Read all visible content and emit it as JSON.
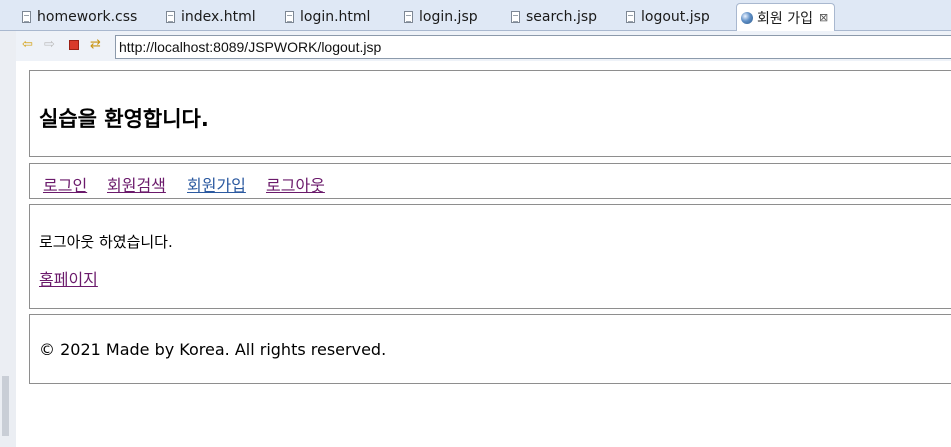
{
  "tabs": [
    {
      "label": "homework.css",
      "icon": "file-icon"
    },
    {
      "label": "index.html",
      "icon": "file-icon"
    },
    {
      "label": "login.html",
      "icon": "file-icon"
    },
    {
      "label": "login.jsp",
      "icon": "file-icon"
    },
    {
      "label": "search.jsp",
      "icon": "file-icon"
    },
    {
      "label": "logout.jsp",
      "icon": "file-icon"
    },
    {
      "label": "회원 가입",
      "icon": "globe-icon",
      "active": true,
      "close": "⊠"
    }
  ],
  "toolbar": {
    "back_icon": "⇦",
    "forward_icon": "⇨",
    "refresh_icon": "⇄",
    "url": "http://localhost:8089/JSPWORK/logout.jsp"
  },
  "page": {
    "title": "실습을 환영합니다.",
    "nav": [
      {
        "label": "로그인"
      },
      {
        "label": "회원검색"
      },
      {
        "label": "회원가입"
      },
      {
        "label": "로그아웃"
      }
    ],
    "message": "로그아웃 하였습니다.",
    "home_link": "홈페이지",
    "footer": "© 2021 Made by Korea. All rights reserved."
  },
  "colors": {
    "visited_link": "#6b1a6b",
    "link": "#2c5aa0",
    "tabbar_bg": "#dfe8f5"
  }
}
